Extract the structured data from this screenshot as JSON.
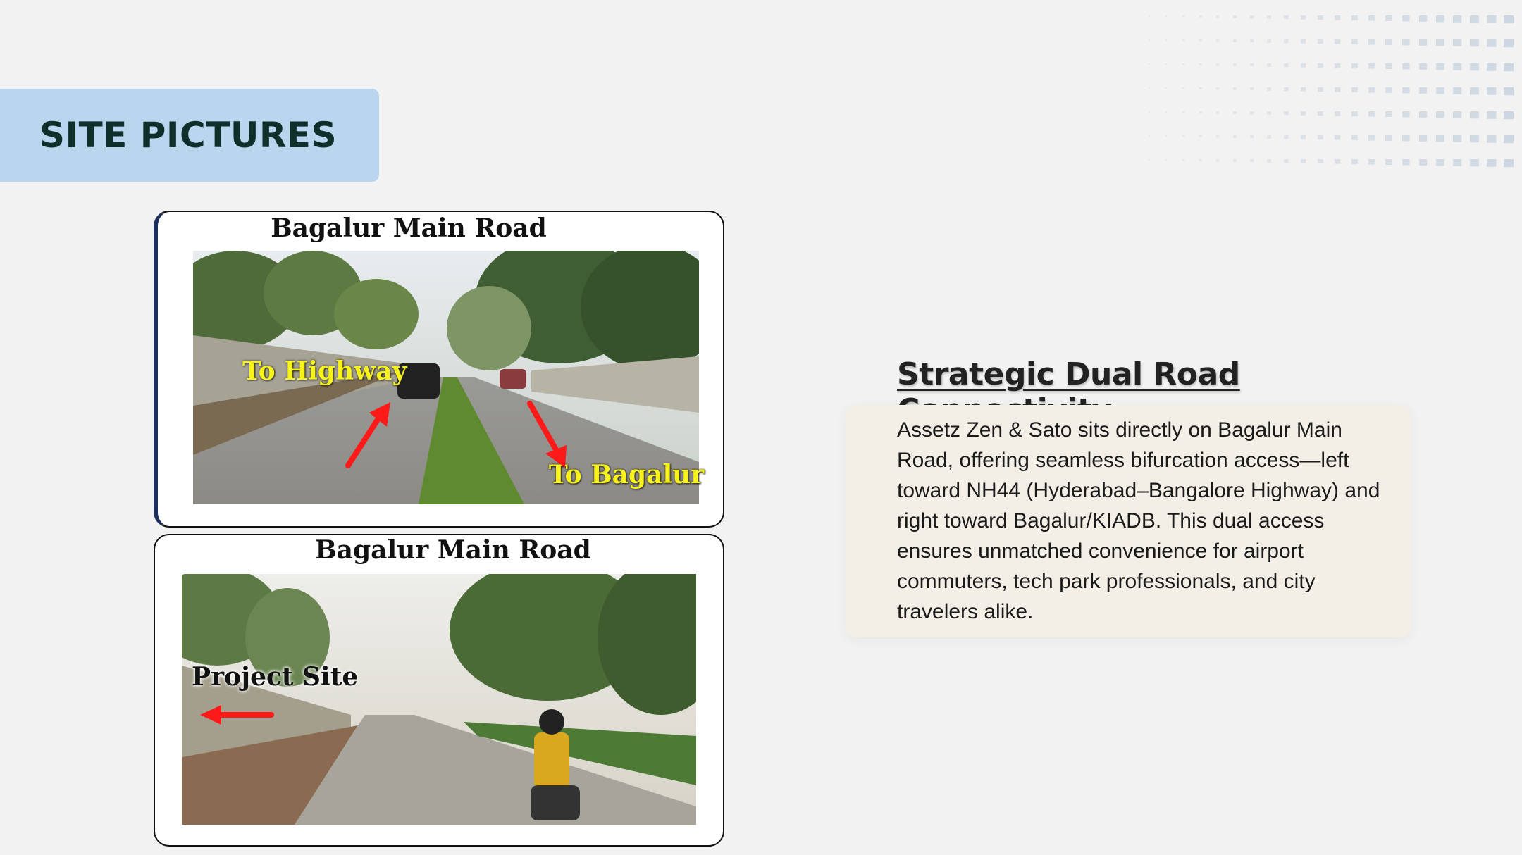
{
  "slide": {
    "title": "SITE PICTURES"
  },
  "photos": [
    {
      "caption": "Bagalur Main Road",
      "labels": [
        "To Highway",
        "To Bagalur"
      ]
    },
    {
      "caption": "Bagalur Main Road",
      "labels": [
        "Project Site"
      ]
    }
  ],
  "info": {
    "heading": "Strategic Dual Road Connectivity",
    "body": "Assetz Zen & Sato sits directly on Bagalur Main Road, offering seamless bifurcation access—left toward NH44 (Hyderabad–Bangalore Highway) and right toward Bagalur/KIADB. This dual access ensures unmatched convenience for airport commuters, tech park professionals, and city travelers alike."
  },
  "colors": {
    "title_box": "#bad6ef",
    "title_text": "#0e2f2a",
    "label_yellow": "#f7f21a",
    "arrow_red": "#ff1a1a",
    "desc_card": "#f4efe6"
  },
  "icons": {
    "arrow_up_right": "red-arrow-up-icon",
    "arrow_down_right": "red-arrow-down-icon",
    "arrow_left": "red-arrow-left-icon"
  }
}
